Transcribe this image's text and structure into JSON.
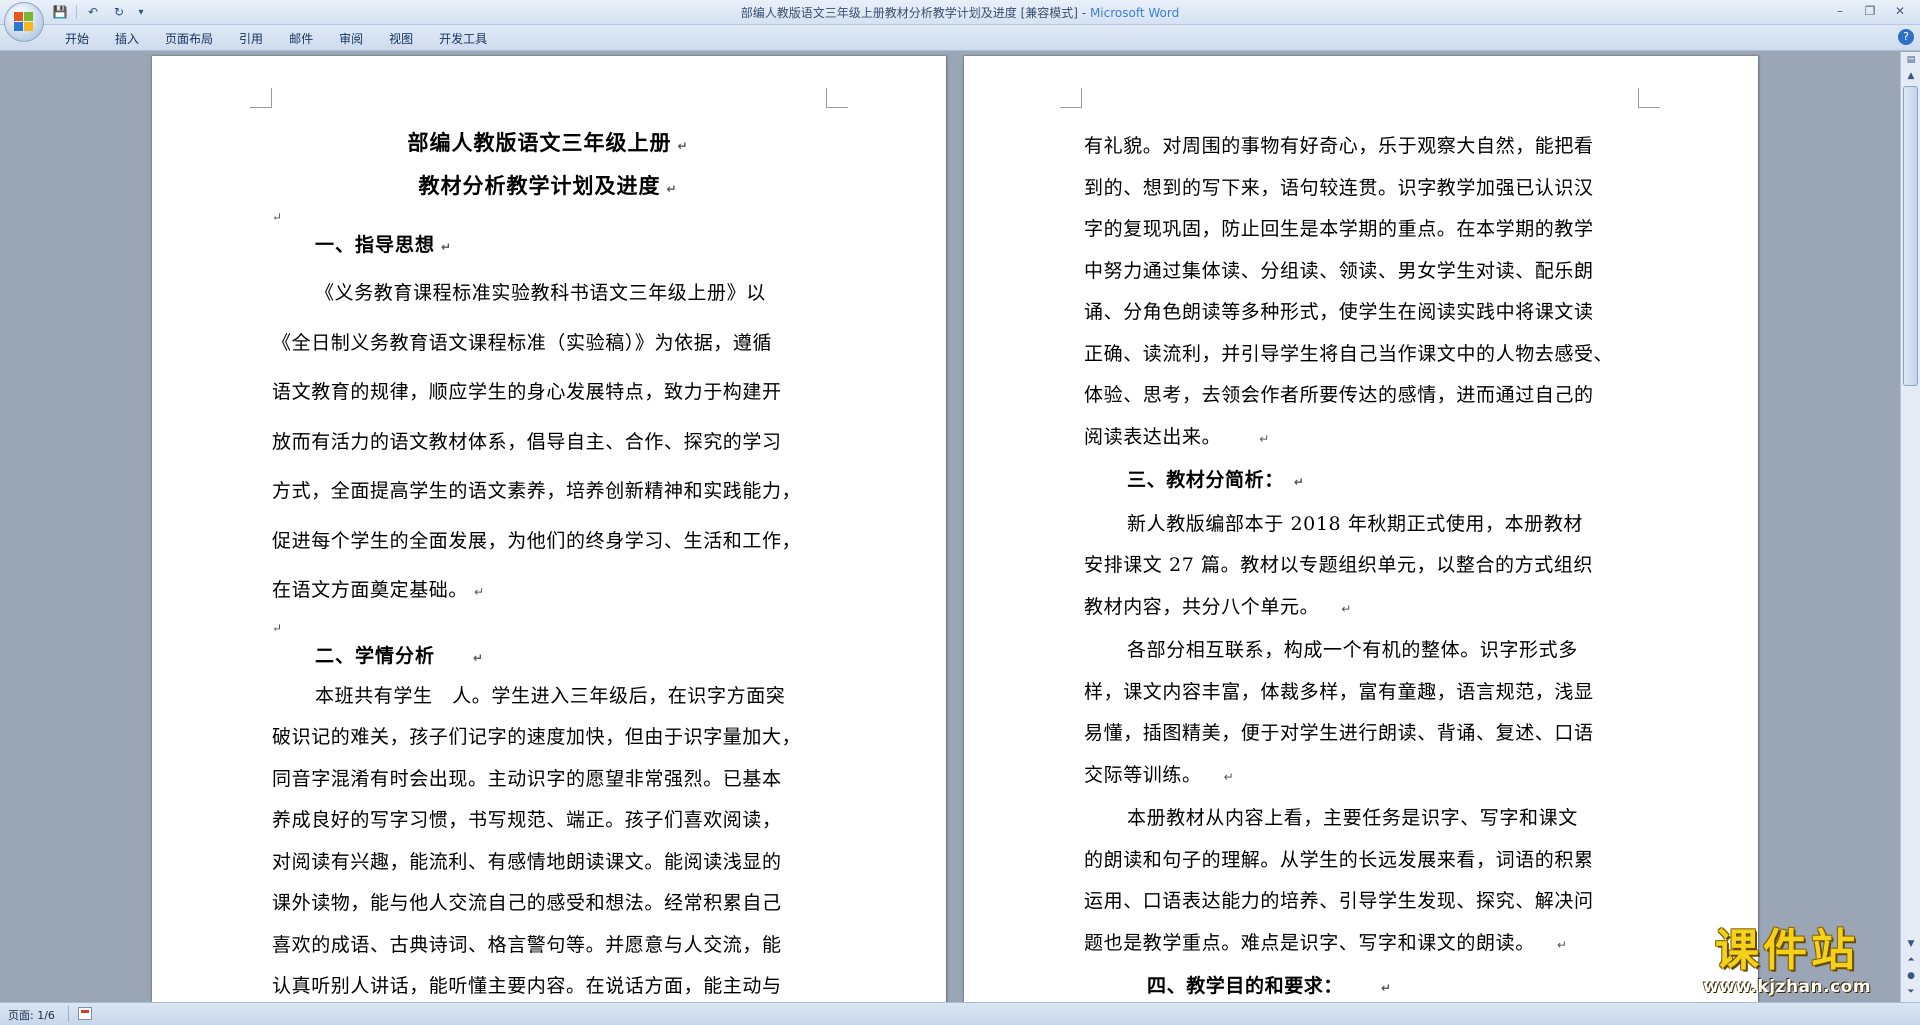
{
  "window": {
    "title_doc": "部编人教版语文三年级上册教材分析教学计划及进度 [兼容模式]",
    "title_app": "Microsoft Word",
    "minimize": "–",
    "maximize": "❐",
    "close": "✕"
  },
  "quick_access": {
    "save": "💾",
    "undo": "↶",
    "redo": "↻",
    "customize": "▾"
  },
  "ribbon": {
    "tabs": [
      "开始",
      "插入",
      "页面布局",
      "引用",
      "邮件",
      "审阅",
      "视图",
      "开发工具"
    ],
    "help": "?"
  },
  "doc": {
    "paragraph_mark": "↵",
    "left": {
      "title1": "部编人教版语文三年级上册",
      "title2": "教材分析教学计划及进度",
      "heading1": "一、指导思想",
      "sec1_lines": [
        "《义务教育课程标准实验教科书语文三年级上册》以",
        "《全日制义务教育语文课程标准（实验稿）》为依据，遵循",
        "语文教育的规律，顺应学生的身心发展特点，致力于构建开",
        "放而有活力的语文教材体系，倡导自主、合作、探究的学习",
        "方式，全面提高学生的语文素养，培养创新精神和实践能力，",
        "促进每个学生的全面发展，为他们的终身学习、生活和工作，",
        "在语文方面奠定基础。"
      ],
      "heading2": "二、学情分析",
      "sec2_lines": [
        "本班共有学生　人。学生进入三年级后，在识字方面突",
        "破识记的难关，孩子们记字的速度加快，但由于识字量加大，",
        "同音字混淆有时会出现。主动识字的愿望非常强烈。已基本",
        "养成良好的写字习惯，书写规范、端正。孩子们喜欢阅读，",
        "对阅读有兴趣，能流利、有感情地朗读课文。能阅读浅显的",
        "课外读物，能与他人交流自己的感受和想法。经常积累自己",
        "喜欢的成语、古典诗词、格言警句等。并愿意与人交流，能",
        "认真听别人讲话，能听懂主要内容。在说话方面，能主动与"
      ]
    },
    "right": {
      "cont_lines": [
        "有礼貌。对周围的事物有好奇心，乐于观察大自然，能把看",
        "到的、想到的写下来，语句较连贯。识字教学加强已认识汉",
        "字的复现巩固，防止回生是本学期的重点。在本学期的教学",
        "中努力通过集体读、分组读、领读、男女学生对读、配乐朗",
        "诵、分角色朗读等多种形式，使学生在阅读实践中将课文读",
        "正确、读流利，并引导学生将自己当作课文中的人物去感受、",
        "体验、思考，去领会作者所要传达的感情，进而通过自己的",
        "阅读表达出来。"
      ],
      "heading3": "三、教材分简析：",
      "p1_lines": [
        "新人教版编部本于 2018 年秋期正式使用，本册教材",
        "安排课文 27 篇。教材以专题组织单元，以整合的方式组织",
        "教材内容，共分八个单元。"
      ],
      "p2_lines": [
        "各部分相互联系，构成一个有机的整体。识字形式多",
        "样，课文内容丰富，体裁多样，富有童趣，语言规范，浅显",
        "易懂，插图精美，便于对学生进行朗读、背诵、复述、口语",
        "交际等训练。"
      ],
      "p3_lines": [
        "本册教材从内容上看，主要任务是识字、写字和课文",
        "的朗读和句子的理解。从学生的长远发展来看，词语的积累",
        "运用、口语表达能力的培养、引导学生发现、探究、解决问",
        "题也是教学重点。难点是识字、写字和课文的朗读。"
      ],
      "heading4": "四、教学目的和要求："
    }
  },
  "statusbar": {
    "page_info": "页面: 1/6"
  },
  "watermark": {
    "brand": "课件站",
    "url": "www.kjzhan.com"
  }
}
